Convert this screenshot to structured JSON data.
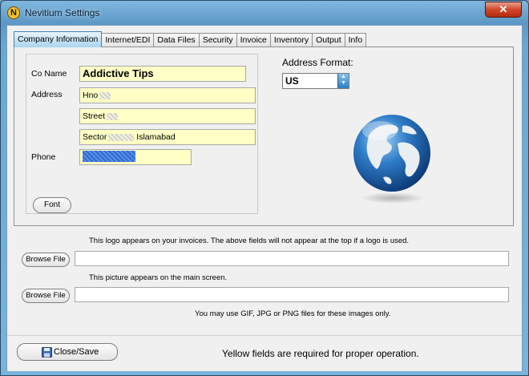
{
  "window": {
    "title": "Nevitium Settings",
    "app_icon_letter": "N",
    "close_glyph": "✕"
  },
  "tabs": [
    {
      "label": "Company Information",
      "active": true
    },
    {
      "label": "Internet/EDI"
    },
    {
      "label": "Data Files"
    },
    {
      "label": "Security"
    },
    {
      "label": "Invoice"
    },
    {
      "label": "Inventory"
    },
    {
      "label": "Output"
    },
    {
      "label": "Info"
    }
  ],
  "company": {
    "co_name_label": "Co Name",
    "co_name_value": "Addictive Tips",
    "address_label": "Address",
    "address_line1": "Hno",
    "address_line2": "Street",
    "address_line3_prefix": "Sector",
    "address_line3_suffix": "Islamabad",
    "phone_label": "Phone",
    "font_button": "Font"
  },
  "address_format": {
    "label": "Address Format:",
    "selected": "US"
  },
  "logo": {
    "note": "This logo appears on your invoices.  The above fields will not appear at the top if a logo is used.",
    "browse_label": "Browse File",
    "path_value": ""
  },
  "picture": {
    "note": "This picture appears on the main screen.",
    "browse_label": "Browse File",
    "path_value": ""
  },
  "formats_note": "You may use GIF, JPG or PNG files for these images only.",
  "footer": {
    "close_save_label": "Close/Save",
    "required_note": "Yellow fields are required for proper operation."
  },
  "colors": {
    "required_field": "#ffffc6",
    "active_tab": "#a9d4f1",
    "close_button": "#d0462a"
  },
  "icons": [
    "nevitium-app-icon",
    "close-icon",
    "spinner-arrows-icon",
    "globe-icon",
    "floppy-disk-icon"
  ]
}
